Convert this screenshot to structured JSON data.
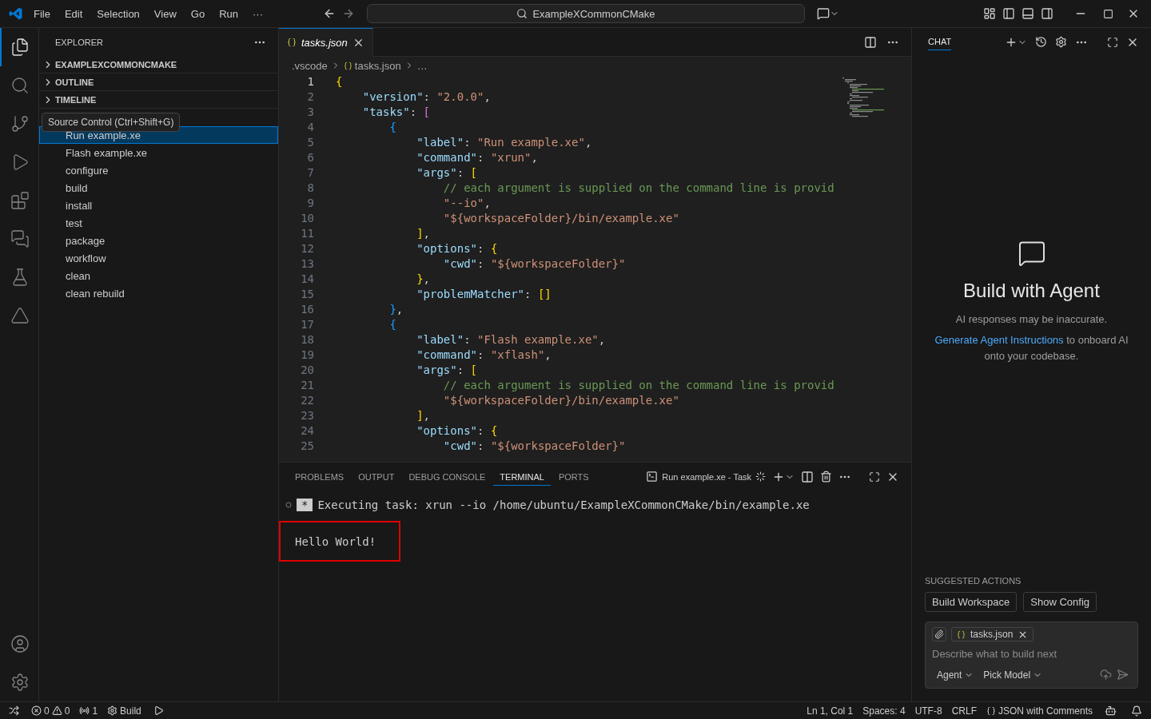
{
  "title_bar": {
    "menu": [
      "File",
      "Edit",
      "Selection",
      "View",
      "Go",
      "Run",
      "···"
    ],
    "search": "ExampleXCommonCMake"
  },
  "activity_bar": {
    "top": [
      {
        "kind": "explorer",
        "selected": true
      },
      {
        "kind": "search",
        "selected": false
      },
      {
        "kind": "source_control",
        "selected": false
      },
      {
        "kind": "run",
        "selected": false
      },
      {
        "kind": "extensions",
        "selected": false
      },
      {
        "kind": "chat",
        "selected": false
      },
      {
        "kind": "testing",
        "selected": false
      },
      {
        "kind": "cmake",
        "selected": false
      }
    ],
    "bottom": [
      {
        "kind": "account",
        "selected": false
      },
      {
        "kind": "manage",
        "selected": false
      }
    ]
  },
  "tooltip": "Source Control (Ctrl+Shift+G)",
  "sidebar": {
    "title": "EXPLORER",
    "sections": [
      {
        "label": "EXAMPLEXCOMMONCMAKE",
        "expanded": false
      },
      {
        "label": "OUTLINE",
        "expanded": false
      },
      {
        "label": "TIMELINE",
        "expanded": false
      }
    ],
    "tasks": [
      {
        "label": "Run example.xe",
        "selected": true
      },
      {
        "label": "Flash example.xe",
        "selected": false
      },
      {
        "label": "configure",
        "selected": false
      },
      {
        "label": "build",
        "selected": false
      },
      {
        "label": "install",
        "selected": false
      },
      {
        "label": "test",
        "selected": false
      },
      {
        "label": "package",
        "selected": false
      },
      {
        "label": "workflow",
        "selected": false
      },
      {
        "label": "clean",
        "selected": false
      },
      {
        "label": "clean rebuild",
        "selected": false
      }
    ]
  },
  "editor": {
    "tabs": [
      {
        "label": "tasks.json",
        "selected": true
      }
    ],
    "breadcrumbs": [
      ".vscode",
      "tasks.json",
      "…"
    ],
    "lines": [
      {
        "number": "1",
        "tokens": [
          {
            "kind": "b1",
            "text": "{"
          }
        ]
      },
      {
        "number": "2",
        "tokens": [
          {
            "kind": "key",
            "text": "    \"version\""
          },
          {
            "kind": "punct",
            "text": ": "
          },
          {
            "kind": "str",
            "text": "\"2.0.0\""
          },
          {
            "kind": "punct",
            "text": ","
          }
        ]
      },
      {
        "number": "3",
        "tokens": [
          {
            "kind": "key",
            "text": "    \"tasks\""
          },
          {
            "kind": "punct",
            "text": ": "
          },
          {
            "kind": "b2",
            "text": "["
          }
        ]
      },
      {
        "number": "4",
        "tokens": [
          {
            "kind": "b3",
            "text": "        {"
          }
        ]
      },
      {
        "number": "5",
        "tokens": [
          {
            "kind": "key",
            "text": "            \"label\""
          },
          {
            "kind": "punct",
            "text": ": "
          },
          {
            "kind": "str",
            "text": "\"Run example.xe\""
          },
          {
            "kind": "punct",
            "text": ","
          }
        ]
      },
      {
        "number": "6",
        "tokens": [
          {
            "kind": "key",
            "text": "            \"command\""
          },
          {
            "kind": "punct",
            "text": ": "
          },
          {
            "kind": "str",
            "text": "\"xrun\""
          },
          {
            "kind": "punct",
            "text": ","
          }
        ]
      },
      {
        "number": "7",
        "tokens": [
          {
            "kind": "key",
            "text": "            \"args\""
          },
          {
            "kind": "punct",
            "text": ": "
          },
          {
            "kind": "b1",
            "text": "["
          }
        ]
      },
      {
        "number": "8",
        "tokens": [
          {
            "kind": "comment",
            "text": "                // each argument is supplied on the command line is provid"
          }
        ]
      },
      {
        "number": "9",
        "tokens": [
          {
            "kind": "str",
            "text": "                \"--io\""
          },
          {
            "kind": "punct",
            "text": ","
          }
        ]
      },
      {
        "number": "10",
        "tokens": [
          {
            "kind": "str",
            "text": "                \"${workspaceFolder}/bin/example.xe\""
          }
        ]
      },
      {
        "number": "11",
        "tokens": [
          {
            "kind": "b1",
            "text": "            ]"
          },
          {
            "kind": "punct",
            "text": ","
          }
        ]
      },
      {
        "number": "12",
        "tokens": [
          {
            "kind": "key",
            "text": "            \"options\""
          },
          {
            "kind": "punct",
            "text": ": "
          },
          {
            "kind": "b1",
            "text": "{"
          }
        ]
      },
      {
        "number": "13",
        "tokens": [
          {
            "kind": "key",
            "text": "                \"cwd\""
          },
          {
            "kind": "punct",
            "text": ": "
          },
          {
            "kind": "str",
            "text": "\"${workspaceFolder}\""
          }
        ]
      },
      {
        "number": "14",
        "tokens": [
          {
            "kind": "b1",
            "text": "            }"
          },
          {
            "kind": "punct",
            "text": ","
          }
        ]
      },
      {
        "number": "15",
        "tokens": [
          {
            "kind": "key",
            "text": "            \"problemMatcher\""
          },
          {
            "kind": "punct",
            "text": ": "
          },
          {
            "kind": "b1",
            "text": "[]"
          }
        ]
      },
      {
        "number": "16",
        "tokens": [
          {
            "kind": "b3",
            "text": "        }"
          },
          {
            "kind": "punct",
            "text": ","
          }
        ]
      },
      {
        "number": "17",
        "tokens": [
          {
            "kind": "b3",
            "text": "        {"
          }
        ]
      },
      {
        "number": "18",
        "tokens": [
          {
            "kind": "key",
            "text": "            \"label\""
          },
          {
            "kind": "punct",
            "text": ": "
          },
          {
            "kind": "str",
            "text": "\"Flash example.xe\""
          },
          {
            "kind": "punct",
            "text": ","
          }
        ]
      },
      {
        "number": "19",
        "tokens": [
          {
            "kind": "key",
            "text": "            \"command\""
          },
          {
            "kind": "punct",
            "text": ": "
          },
          {
            "kind": "str",
            "text": "\"xflash\""
          },
          {
            "kind": "punct",
            "text": ","
          }
        ]
      },
      {
        "number": "20",
        "tokens": [
          {
            "kind": "key",
            "text": "            \"args\""
          },
          {
            "kind": "punct",
            "text": ": "
          },
          {
            "kind": "b1",
            "text": "["
          }
        ]
      },
      {
        "number": "21",
        "tokens": [
          {
            "kind": "comment",
            "text": "                // each argument is supplied on the command line is provid"
          }
        ]
      },
      {
        "number": "22",
        "tokens": [
          {
            "kind": "str",
            "text": "                \"${workspaceFolder}/bin/example.xe\""
          }
        ]
      },
      {
        "number": "23",
        "tokens": [
          {
            "kind": "b1",
            "text": "            ]"
          },
          {
            "kind": "punct",
            "text": ","
          }
        ]
      },
      {
        "number": "24",
        "tokens": [
          {
            "kind": "key",
            "text": "            \"options\""
          },
          {
            "kind": "punct",
            "text": ": "
          },
          {
            "kind": "b1",
            "text": "{"
          }
        ]
      },
      {
        "number": "25",
        "tokens": [
          {
            "kind": "key",
            "text": "                \"cwd\""
          },
          {
            "kind": "punct",
            "text": ": "
          },
          {
            "kind": "str",
            "text": "\"${workspaceFolder}\""
          }
        ]
      }
    ]
  },
  "panel": {
    "tabs": [
      {
        "label": "PROBLEMS",
        "selected": false
      },
      {
        "label": "OUTPUT",
        "selected": false
      },
      {
        "label": "DEBUG CONSOLE",
        "selected": false
      },
      {
        "label": "TERMINAL",
        "selected": true
      },
      {
        "label": "PORTS",
        "selected": false
      }
    ],
    "terminal_title": "Run example.xe - Task",
    "prompt_mark": "*",
    "command": "Executing task: xrun --io /home/ubuntu/ExampleXCommonCMake/bin/example.xe",
    "output": "Hello World!",
    "output_highlighted": true
  },
  "chat": {
    "title": "CHAT",
    "heading": "Build with Agent",
    "disclaimer": "AI responses may be inaccurate.",
    "link": "Generate Agent Instructions",
    "link_rest": " to onboard AI onto your codebase.",
    "suggested_title": "SUGGESTED ACTIONS",
    "suggested": [
      "Build Workspace",
      "Show Config"
    ],
    "attachment": "tasks.json",
    "placeholder": "Describe what to build next",
    "mode": "Agent",
    "model": "Pick Model"
  },
  "status_bar": {
    "errors": "0",
    "warnings": "0",
    "ports": "1",
    "task": "Build",
    "items": [
      "Ln 1, Col 1",
      "Spaces: 4",
      "UTF-8",
      "CRLF"
    ],
    "language": "JSON with Comments"
  }
}
